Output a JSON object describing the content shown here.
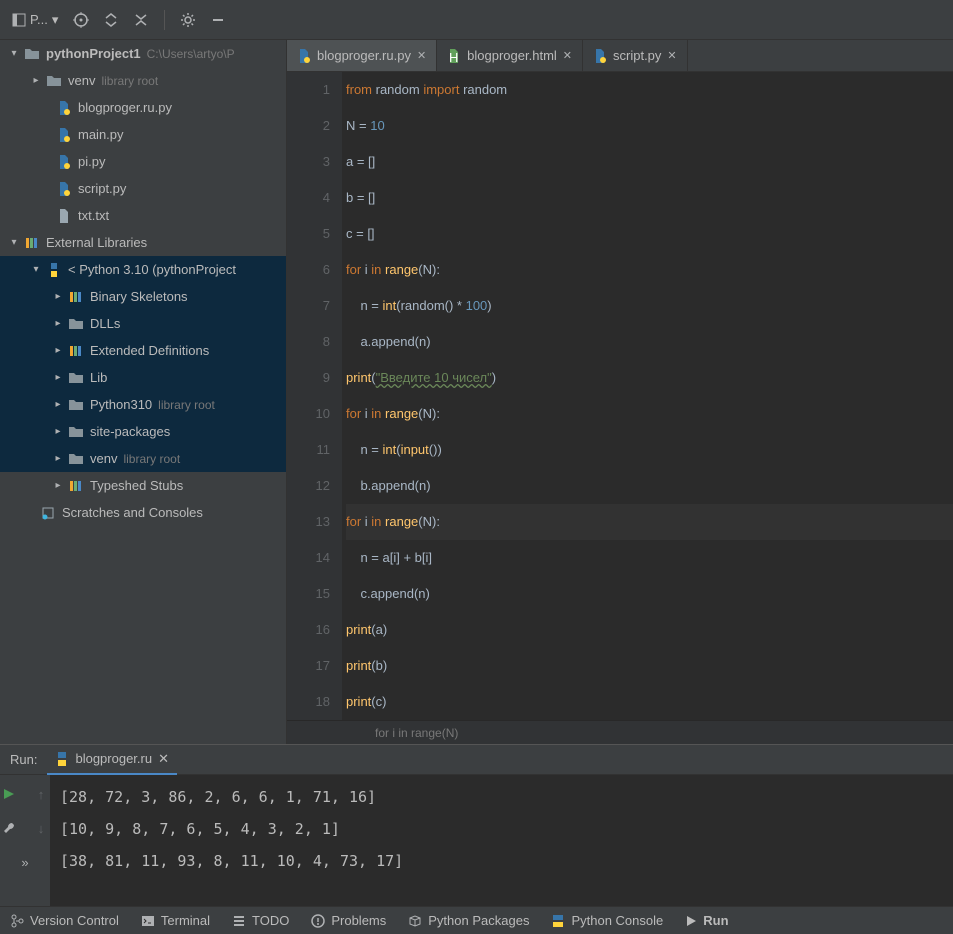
{
  "toolbar": {
    "project_label": "P...",
    "dropdown_chevron": "▾"
  },
  "project_tree": {
    "root": {
      "label": "pythonProject1",
      "hint": "C:\\Users\\artyo\\P"
    },
    "venv": {
      "label": "venv",
      "hint": "library root"
    },
    "files": [
      {
        "label": "blogproger.ru.py"
      },
      {
        "label": "main.py"
      },
      {
        "label": "pi.py"
      },
      {
        "label": "script.py"
      },
      {
        "label": "txt.txt"
      }
    ],
    "external": {
      "label": "External Libraries"
    },
    "python_sdk": {
      "label": "< Python 3.10 (pythonProject"
    },
    "libs": [
      {
        "label": "Binary Skeletons",
        "icon": "lib"
      },
      {
        "label": "DLLs",
        "icon": "folder"
      },
      {
        "label": "Extended Definitions",
        "icon": "lib"
      },
      {
        "label": "Lib",
        "icon": "folder"
      },
      {
        "label": "Python310",
        "icon": "folder",
        "hint": "library root"
      },
      {
        "label": "site-packages",
        "icon": "folder"
      },
      {
        "label": "venv",
        "icon": "folder",
        "hint": "library root"
      },
      {
        "label": "Typeshed Stubs",
        "icon": "lib"
      }
    ],
    "scratches": {
      "label": "Scratches and Consoles"
    }
  },
  "editor_tabs": [
    {
      "label": "blogproger.ru.py",
      "icon": "py",
      "active": true
    },
    {
      "label": "blogproger.html",
      "icon": "html",
      "active": false
    },
    {
      "label": "script.py",
      "icon": "py",
      "active": false
    }
  ],
  "code_lines": [
    {
      "n": 1,
      "tokens": [
        {
          "t": "from ",
          "c": "kw"
        },
        {
          "t": "random ",
          "c": ""
        },
        {
          "t": "import ",
          "c": "kw"
        },
        {
          "t": "random",
          "c": ""
        }
      ]
    },
    {
      "n": 2,
      "tokens": [
        {
          "t": "N = ",
          "c": ""
        },
        {
          "t": "10",
          "c": "num"
        }
      ]
    },
    {
      "n": 3,
      "tokens": [
        {
          "t": "a = []",
          "c": ""
        }
      ]
    },
    {
      "n": 4,
      "tokens": [
        {
          "t": "b = []",
          "c": ""
        }
      ]
    },
    {
      "n": 5,
      "tokens": [
        {
          "t": "c = []",
          "c": ""
        }
      ]
    },
    {
      "n": 6,
      "tokens": [
        {
          "t": "for ",
          "c": "kw"
        },
        {
          "t": "i ",
          "c": ""
        },
        {
          "t": "in ",
          "c": "kw"
        },
        {
          "t": "range",
          "c": "fn"
        },
        {
          "t": "(N):",
          "c": ""
        }
      ]
    },
    {
      "n": 7,
      "tokens": [
        {
          "t": "    n = ",
          "c": ""
        },
        {
          "t": "int",
          "c": "fn"
        },
        {
          "t": "(",
          "c": ""
        },
        {
          "t": "random",
          "c": ""
        },
        {
          "t": "() * ",
          "c": ""
        },
        {
          "t": "100",
          "c": "num"
        },
        {
          "t": ")",
          "c": ""
        }
      ]
    },
    {
      "n": 8,
      "tokens": [
        {
          "t": "    a.append(n)",
          "c": ""
        }
      ]
    },
    {
      "n": 9,
      "tokens": [
        {
          "t": "print",
          "c": "fn"
        },
        {
          "t": "(",
          "c": ""
        },
        {
          "t": "\"Введите 10 чисел\"",
          "c": "str"
        },
        {
          "t": ")",
          "c": ""
        }
      ]
    },
    {
      "n": 10,
      "tokens": [
        {
          "t": "for ",
          "c": "kw"
        },
        {
          "t": "i ",
          "c": ""
        },
        {
          "t": "in ",
          "c": "kw"
        },
        {
          "t": "range",
          "c": "fn"
        },
        {
          "t": "(N):",
          "c": ""
        }
      ]
    },
    {
      "n": 11,
      "tokens": [
        {
          "t": "    n = ",
          "c": ""
        },
        {
          "t": "int",
          "c": "fn"
        },
        {
          "t": "(",
          "c": ""
        },
        {
          "t": "input",
          "c": "fn"
        },
        {
          "t": "())",
          "c": ""
        }
      ]
    },
    {
      "n": 12,
      "tokens": [
        {
          "t": "    b.append(n)",
          "c": ""
        }
      ]
    },
    {
      "n": 13,
      "cursor": true,
      "tokens": [
        {
          "t": "for ",
          "c": "kw"
        },
        {
          "t": "i ",
          "c": ""
        },
        {
          "t": "in ",
          "c": "kw"
        },
        {
          "t": "range",
          "c": "fn"
        },
        {
          "t": "(N):",
          "c": ""
        }
      ]
    },
    {
      "n": 14,
      "tokens": [
        {
          "t": "    n = a[i] + b[i]",
          "c": ""
        }
      ]
    },
    {
      "n": 15,
      "tokens": [
        {
          "t": "    c.append(n)",
          "c": ""
        }
      ]
    },
    {
      "n": 16,
      "tokens": [
        {
          "t": "print",
          "c": "fn"
        },
        {
          "t": "(a)",
          "c": ""
        }
      ]
    },
    {
      "n": 17,
      "tokens": [
        {
          "t": "print",
          "c": "fn"
        },
        {
          "t": "(b)",
          "c": ""
        }
      ]
    },
    {
      "n": 18,
      "tokens": [
        {
          "t": "print",
          "c": "fn"
        },
        {
          "t": "(c)",
          "c": ""
        }
      ]
    }
  ],
  "breadcrumb": "for i in range(N)",
  "run": {
    "label": "Run:",
    "tab": "blogproger.ru",
    "output": [
      "[28, 72, 3, 86, 2, 6, 6, 1, 71, 16]",
      "[10, 9, 8, 7, 6, 5, 4, 3, 2, 1]",
      "[38, 81, 11, 93, 8, 11, 10, 4, 73, 17]"
    ]
  },
  "bottom_bar": [
    {
      "label": "Version Control",
      "icon": "branch"
    },
    {
      "label": "Terminal",
      "icon": "terminal"
    },
    {
      "label": "TODO",
      "icon": "todo"
    },
    {
      "label": "Problems",
      "icon": "problems"
    },
    {
      "label": "Python Packages",
      "icon": "packages"
    },
    {
      "label": "Python Console",
      "icon": "console"
    },
    {
      "label": "Run",
      "icon": "run",
      "active": true
    }
  ]
}
